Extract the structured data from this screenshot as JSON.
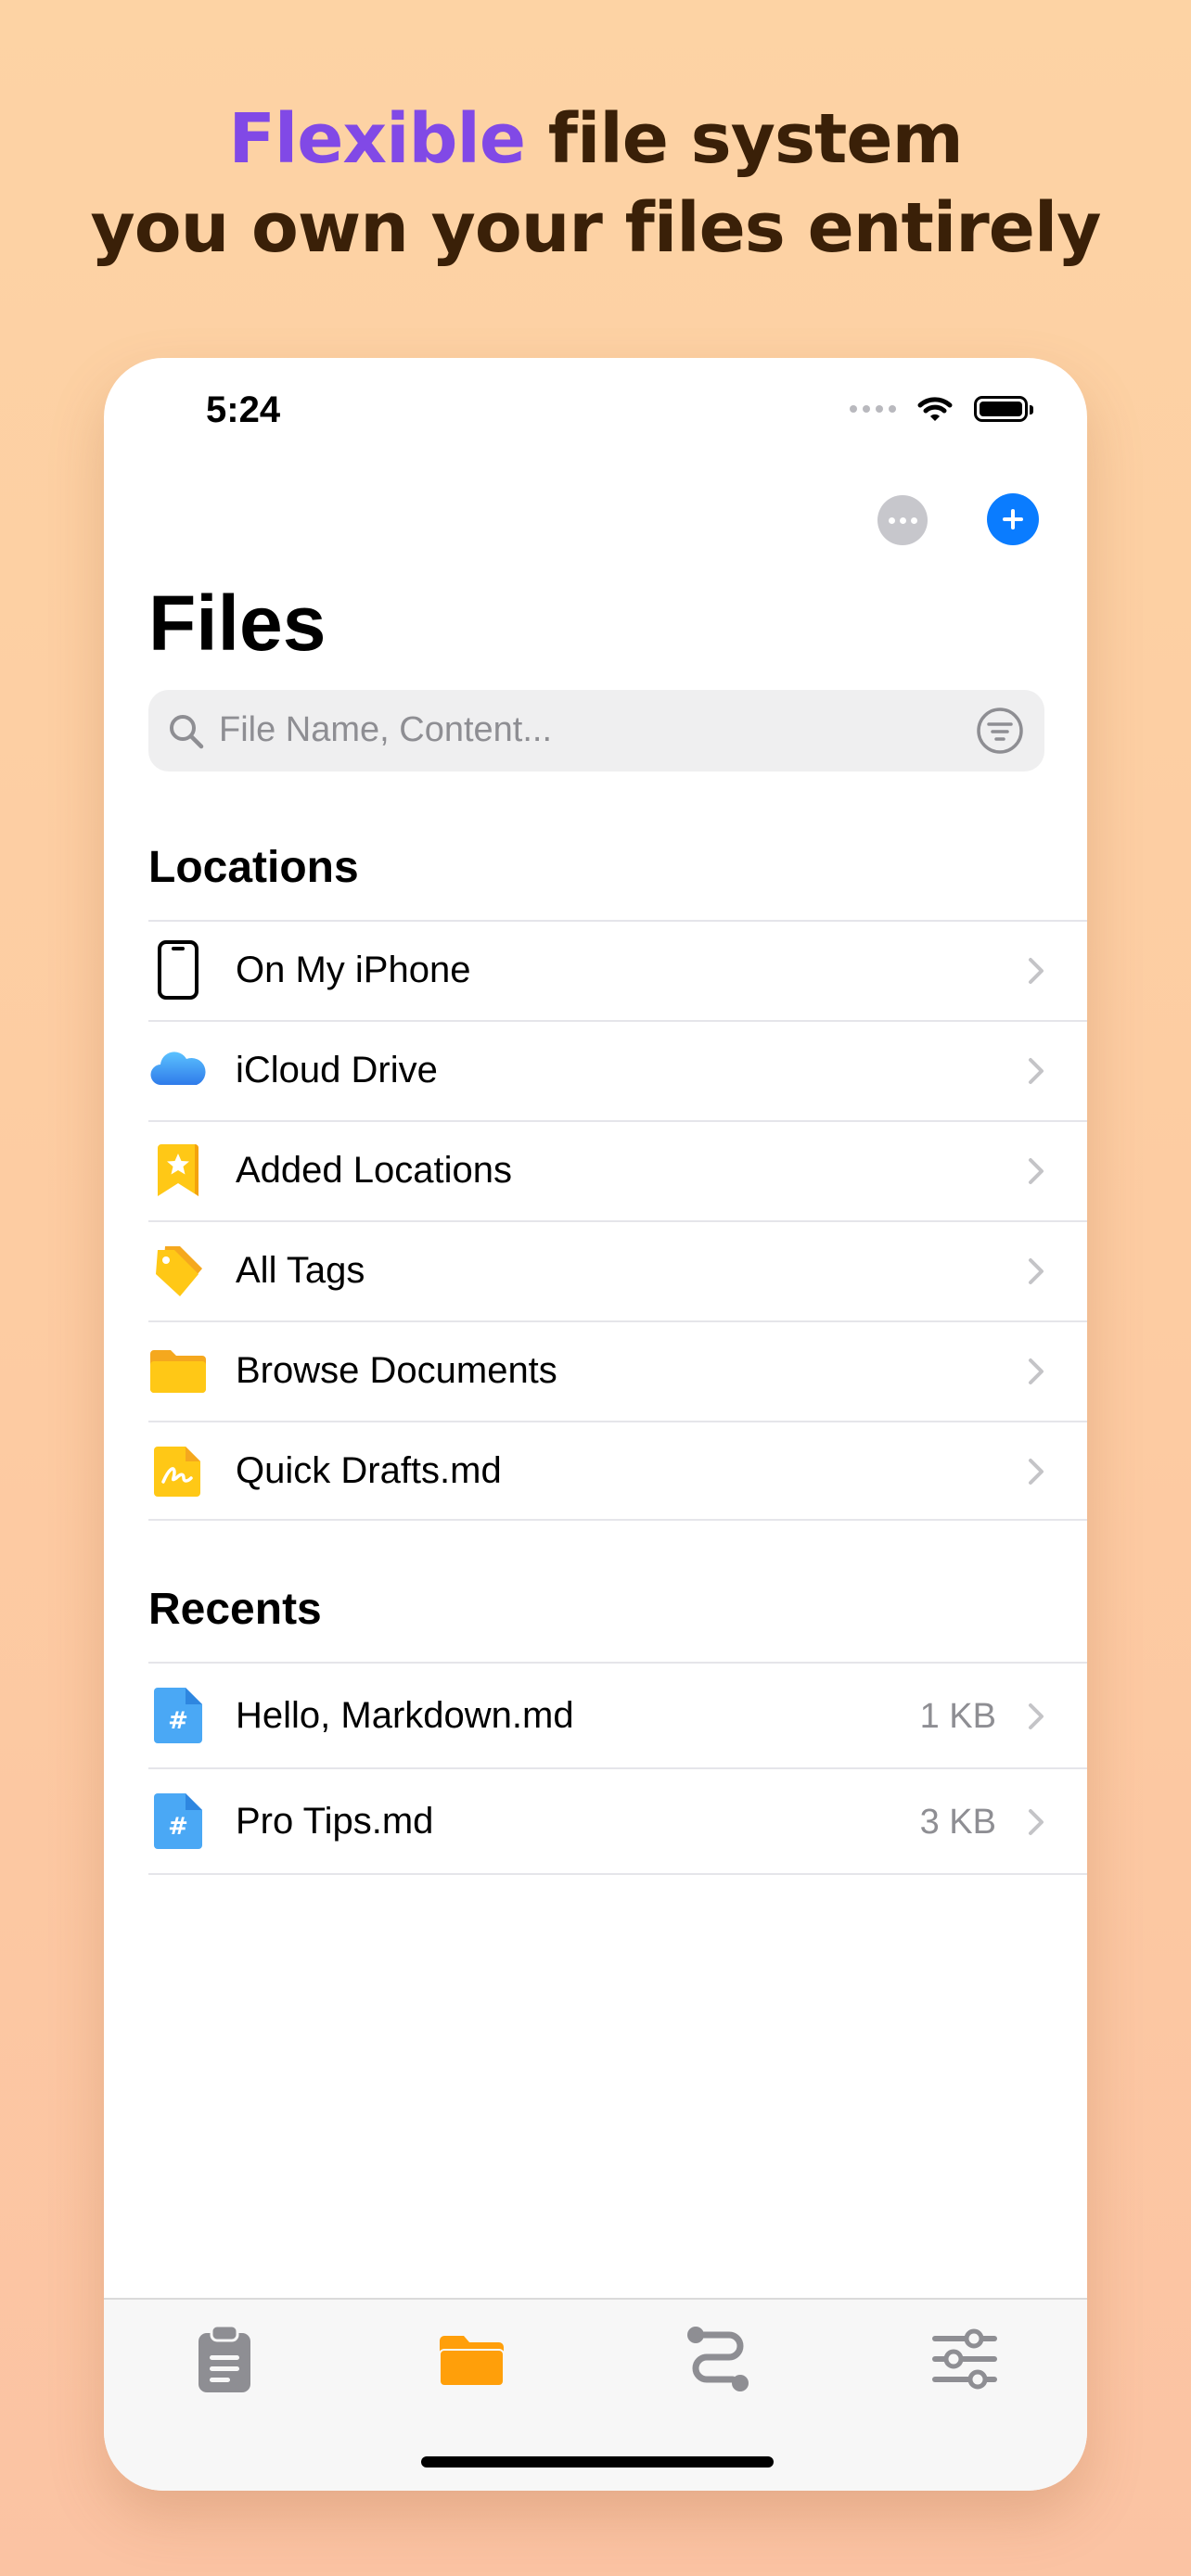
{
  "headline": {
    "accent": "Flexible",
    "line1_rest": " file system",
    "line2": "you own your files entirely"
  },
  "status_bar": {
    "time": "5:24"
  },
  "nav": {
    "title": "Files"
  },
  "search": {
    "placeholder": "File Name, Content..."
  },
  "sections": {
    "locations": {
      "title": "Locations",
      "items": [
        {
          "label": "On My iPhone",
          "icon": "iphone-icon"
        },
        {
          "label": "iCloud Drive",
          "icon": "icloud-icon"
        },
        {
          "label": "Added Locations",
          "icon": "bookmark-star-icon"
        },
        {
          "label": "All Tags",
          "icon": "tags-icon"
        },
        {
          "label": "Browse Documents",
          "icon": "folder-icon"
        },
        {
          "label": "Quick Drafts.md",
          "icon": "draft-file-icon"
        }
      ]
    },
    "recents": {
      "title": "Recents",
      "items": [
        {
          "label": "Hello, Markdown.md",
          "size": "1 KB",
          "icon": "markdown-file-icon"
        },
        {
          "label": "Pro Tips.md",
          "size": "3 KB",
          "icon": "markdown-file-icon"
        }
      ]
    }
  },
  "tab_bar": {
    "tabs": [
      {
        "name": "notes-tab",
        "icon": "clipboard-icon",
        "active": false
      },
      {
        "name": "files-tab",
        "icon": "folder-icon",
        "active": true
      },
      {
        "name": "workflow-tab",
        "icon": "route-icon",
        "active": false
      },
      {
        "name": "settings-tab",
        "icon": "sliders-icon",
        "active": false
      }
    ]
  },
  "colors": {
    "accent_purple": "#8149E6",
    "headline_brown": "#3A2008",
    "ios_blue": "#0A7CFF",
    "folder_orange": "#FF9F0A",
    "folder_yellow": "#FFC816"
  }
}
